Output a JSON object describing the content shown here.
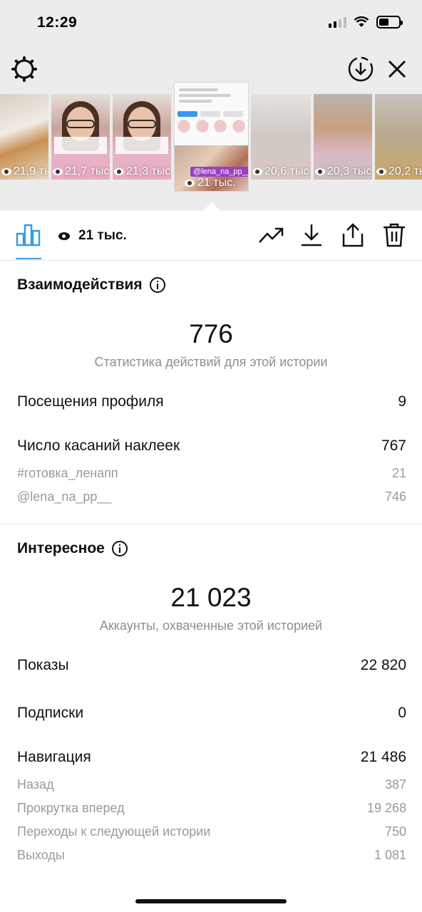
{
  "status_bar": {
    "time": "12:29",
    "battery_level": 0.5
  },
  "header": {
    "settings_icon": "gear-icon",
    "download_icon": "download-circle-icon",
    "close_icon": "close-icon"
  },
  "story_strip": {
    "thumbnails": [
      {
        "views": "21,9 тыс."
      },
      {
        "views": "21,7 тыс."
      },
      {
        "views": "21,3 тыс."
      },
      {
        "views": "21 тыс.",
        "selected": true,
        "tag": "@lena_na_pp__"
      },
      {
        "views": "20,6 тыс."
      },
      {
        "views": "20,3 тыс."
      },
      {
        "views": "20,2 тыс."
      }
    ]
  },
  "toolbar": {
    "views": "21 тыс.",
    "icons": [
      "bar-chart-icon",
      "trending-icon",
      "download-icon",
      "share-icon",
      "trash-icon"
    ]
  },
  "interactions": {
    "title": "Взаимодействия",
    "total": "776",
    "total_caption": "Статистика действий для этой истории",
    "profile_visits_label": "Посещения профиля",
    "profile_visits_value": "9",
    "sticker_taps_label": "Число касаний наклеек",
    "sticker_taps_value": "767",
    "sticker_rows": [
      {
        "label": "#готовка_ленапп",
        "value": "21"
      },
      {
        "label": "@lena_na_pp__",
        "value": "746"
      }
    ]
  },
  "discovery": {
    "title": "Интересное",
    "total": "21 023",
    "total_caption": "Аккаунты, охваченные этой историей",
    "impressions_label": "Показы",
    "impressions_value": "22 820",
    "follows_label": "Подписки",
    "follows_value": "0",
    "navigation_label": "Навигация",
    "navigation_value": "21 486",
    "navigation_rows": [
      {
        "label": "Назад",
        "value": "387"
      },
      {
        "label": "Прокрутка вперед",
        "value": "19 268"
      },
      {
        "label": "Переходы к следующей истории",
        "value": "750"
      },
      {
        "label": "Выходы",
        "value": "1 081"
      }
    ]
  },
  "colors": {
    "accent": "#3b9be6",
    "muted": "#9a9a9a",
    "tag": "#9b3fc4"
  }
}
